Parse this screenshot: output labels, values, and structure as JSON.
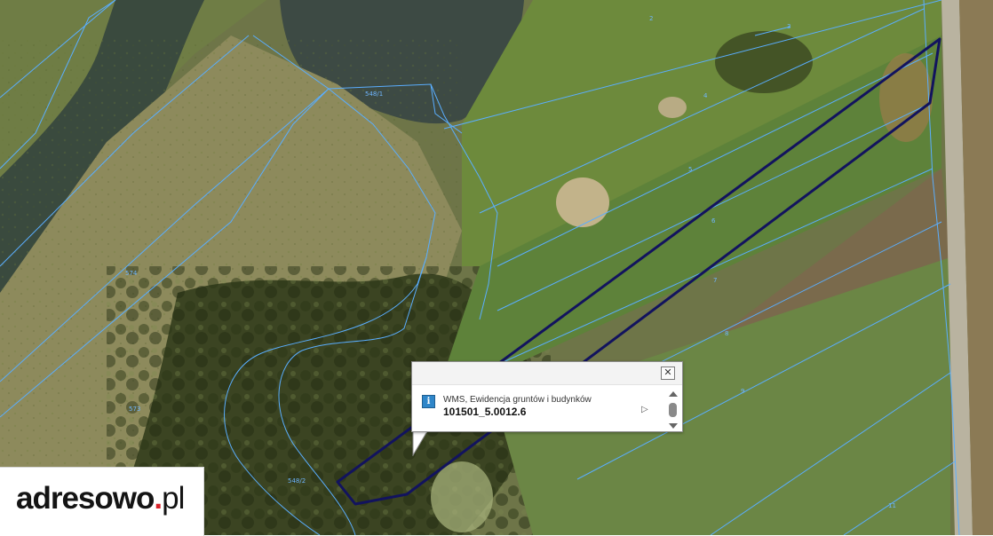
{
  "map": {
    "parcel_labels": [
      "2",
      "3",
      "4",
      "5",
      "6",
      "7",
      "8",
      "9",
      "548/1",
      "548/2",
      "573",
      "574",
      "11"
    ],
    "highlight_color": "#12135e",
    "parcel_line_color": "#5aaeff"
  },
  "popup": {
    "source": "WMS, Ewidencja gruntów i budynków",
    "parcel_id": "101501_5.0012.6",
    "close_glyph": "✕",
    "info_glyph": "i",
    "expand_glyph": "▷",
    "icons": [
      "info-icon",
      "close-icon",
      "expand-arrow-icon",
      "scroll-up-icon",
      "scroll-down-icon"
    ]
  },
  "logo": {
    "name": "adresowo",
    "dot": ".",
    "tld": "pl"
  }
}
